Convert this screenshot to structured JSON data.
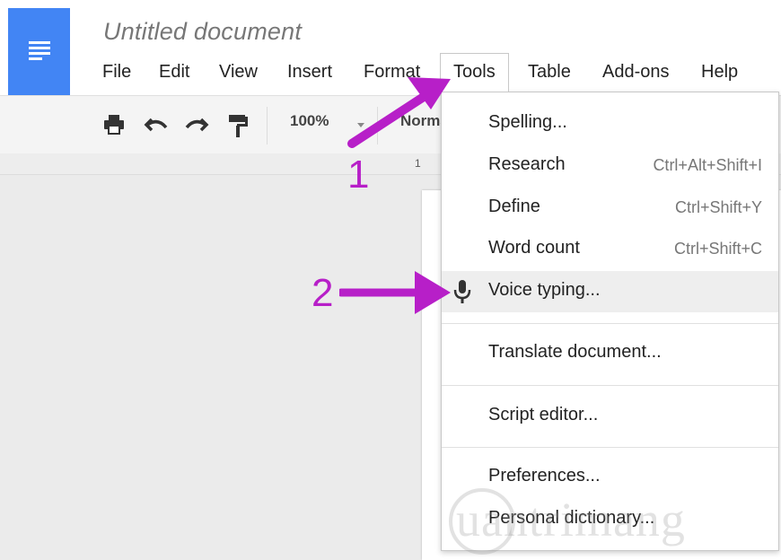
{
  "document": {
    "title": "Untitled document"
  },
  "menubar": {
    "items": [
      "File",
      "Edit",
      "View",
      "Insert",
      "Format",
      "Tools",
      "Table",
      "Add-ons",
      "Help"
    ],
    "active": "Tools"
  },
  "toolbar": {
    "zoom": "100%",
    "style": "Normal text"
  },
  "ruler": {
    "mark": "1"
  },
  "tools_menu": {
    "items": [
      {
        "label": "Spelling...",
        "shortcut": ""
      },
      {
        "label": "Research",
        "shortcut": "Ctrl+Alt+Shift+I"
      },
      {
        "label": "Define",
        "shortcut": "Ctrl+Shift+Y"
      },
      {
        "label": "Word count",
        "shortcut": "Ctrl+Shift+C"
      },
      {
        "label": "Voice typing...",
        "shortcut": ""
      },
      {
        "label": "Translate document...",
        "shortcut": ""
      },
      {
        "label": "Script editor...",
        "shortcut": ""
      },
      {
        "label": "Preferences...",
        "shortcut": ""
      },
      {
        "label": "Personal dictionary...",
        "shortcut": ""
      }
    ]
  },
  "annotations": {
    "step1": "1",
    "step2": "2"
  },
  "watermark": "uantrimang",
  "colors": {
    "docs_blue": "#4285f4",
    "annotation_purple": "#b71fc8",
    "menu_hover": "#eeeeee"
  },
  "icons": [
    "docs-logo-icon",
    "print-icon",
    "undo-icon",
    "redo-icon",
    "paint-format-icon",
    "microphone-icon"
  ]
}
